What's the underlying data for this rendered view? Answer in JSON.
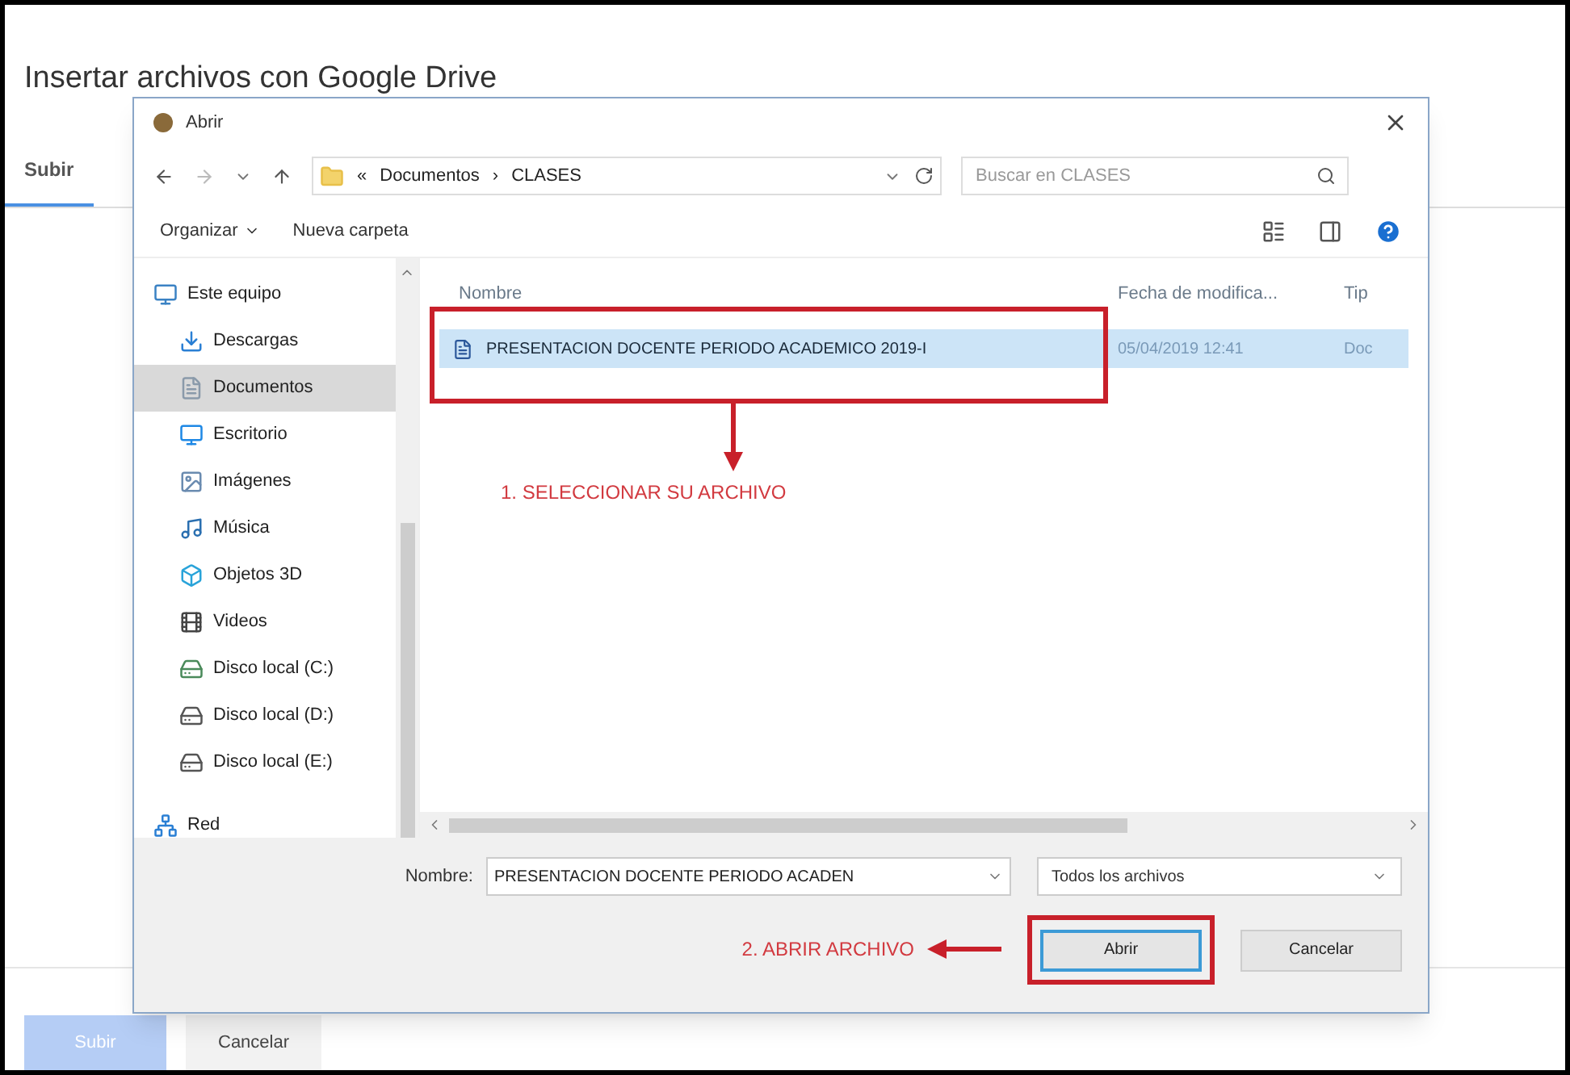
{
  "page": {
    "title": "Insertar archivos con Google Drive",
    "tabs": [
      {
        "label": "Subir",
        "selected": true
      }
    ],
    "buttons": [
      {
        "label": "Subir",
        "primary": true
      },
      {
        "label": "Cancelar",
        "primary": false
      }
    ]
  },
  "dialog": {
    "title": "Abrir",
    "path_prefix": "«",
    "path": [
      "Documentos",
      "CLASES"
    ],
    "path_separator": "›",
    "search": {
      "placeholder": "Buscar en CLASES"
    },
    "toolbar": [
      "Organizar",
      "Nueva carpeta"
    ],
    "nav": [
      {
        "label": "Este equipo",
        "kind": "computer",
        "selected": false,
        "children": [
          {
            "label": "Descargas",
            "kind": "download",
            "selected": false
          },
          {
            "label": "Documentos",
            "kind": "document",
            "selected": true
          },
          {
            "label": "Escritorio",
            "kind": "desktop",
            "selected": false
          },
          {
            "label": "Imágenes",
            "kind": "images",
            "selected": false
          },
          {
            "label": "Música",
            "kind": "music",
            "selected": false
          },
          {
            "label": "Objetos 3D",
            "kind": "cube",
            "selected": false
          },
          {
            "label": "Videos",
            "kind": "video",
            "selected": false
          },
          {
            "label": "Disco local (C:)",
            "kind": "system-drive",
            "selected": false
          },
          {
            "label": "Disco local (D:)",
            "kind": "drive",
            "selected": false
          },
          {
            "label": "Disco local (E:)",
            "kind": "drive",
            "selected": false
          }
        ]
      },
      {
        "label": "Red",
        "kind": "network",
        "selected": false
      }
    ],
    "columns": [
      "Nombre",
      "Fecha de modifica...",
      "Tip"
    ],
    "files": [
      {
        "cells": [
          "PRESENTACION DOCENTE PERIODO ACADEMICO 2019-I",
          "05/04/2019 12:41",
          "Doc"
        ],
        "selected": true
      }
    ],
    "annotations": [
      {
        "text": "1. SELECCIONAR SU ARCHIVO"
      },
      {
        "text": "2. ABRIR ARCHIVO"
      }
    ],
    "filename_label": "Nombre:",
    "filename": "PRESENTACION DOCENTE PERIODO ACADEN",
    "filter": "Todos los archivos",
    "buttons": [
      {
        "label": "Abrir",
        "primary": true
      },
      {
        "label": "Cancelar",
        "primary": false
      }
    ]
  }
}
